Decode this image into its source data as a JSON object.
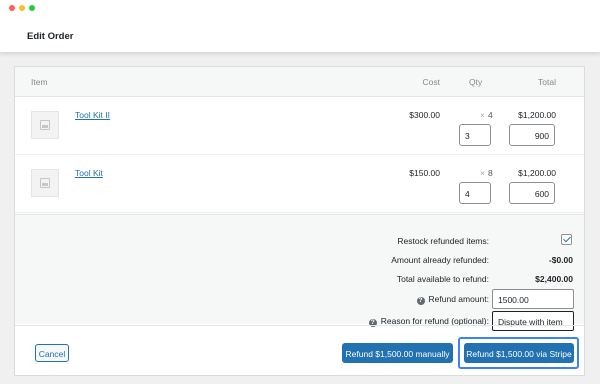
{
  "window": {
    "controls": [
      "close",
      "minimize",
      "zoom"
    ],
    "colors": [
      "#ff5f57",
      "#febc2e",
      "#28c840"
    ]
  },
  "page": {
    "title": "Edit Order"
  },
  "table": {
    "headers": {
      "item": "Item",
      "cost": "Cost",
      "qty": "Qty",
      "total": "Total"
    },
    "rows": [
      {
        "name": "Tool Kit II",
        "cost": "$300.00",
        "qty_symbol": "×",
        "qty": "4",
        "total": "$1,200.00",
        "refund_qty": "3",
        "refund_total": "900"
      },
      {
        "name": "Tool Kit",
        "cost": "$150.00",
        "qty_symbol": "×",
        "qty": "8",
        "total": "$1,200.00",
        "refund_qty": "4",
        "refund_total": "600"
      }
    ]
  },
  "refund": {
    "restock_label": "Restock refunded items:",
    "restock_checked": true,
    "already_label": "Amount already refunded:",
    "already_value": "-$0.00",
    "available_label": "Total available to refund:",
    "available_value": "$2,400.00",
    "help_glyph": "?",
    "amount_label": "Refund amount:",
    "amount_value": "1500.00",
    "reason_label": "Reason for refund (optional):",
    "reason_value": "Dispute with item"
  },
  "footer": {
    "cancel": "Cancel",
    "manual": "Refund $1,500.00 manually",
    "stripe": "Refund $1,500.00 via Stripe"
  },
  "colors": {
    "accent": "#2271b1",
    "highlight": "#3b82f6"
  }
}
